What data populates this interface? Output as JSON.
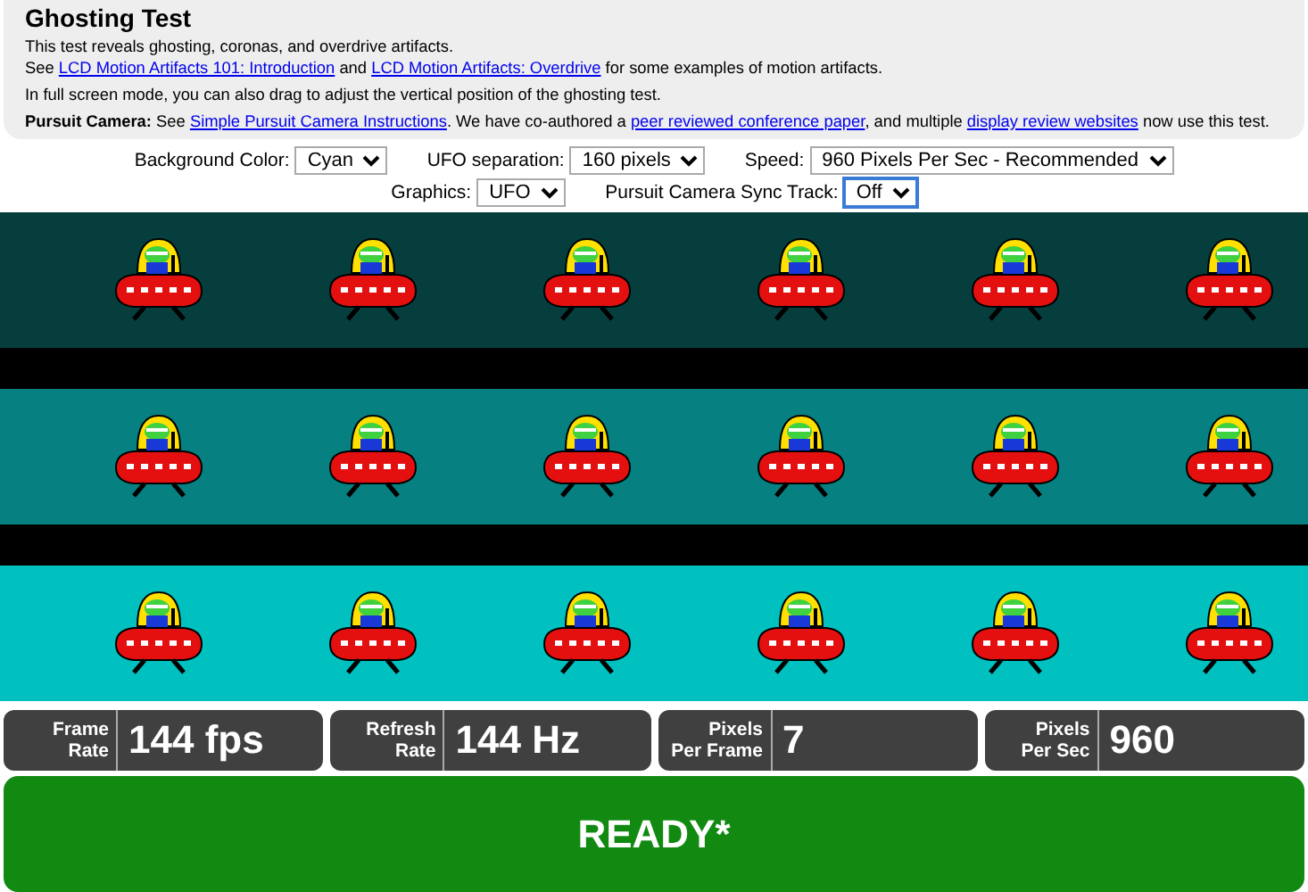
{
  "title": "Ghosting Test",
  "paragraphs": [
    [
      {
        "kind": "text",
        "text": "This test reveals ghosting, coronas, and overdrive artifacts."
      }
    ],
    [
      {
        "kind": "text",
        "text": "See "
      },
      {
        "kind": "link",
        "text": "LCD Motion Artifacts 101: Introduction"
      },
      {
        "kind": "text",
        "text": " and "
      },
      {
        "kind": "link",
        "text": "LCD Motion Artifacts: Overdrive"
      },
      {
        "kind": "text",
        "text": " for some examples of motion artifacts."
      }
    ],
    [
      {
        "kind": "text",
        "text": "In full screen mode, you can also drag to adjust the vertical position of the ghosting test."
      }
    ],
    [
      {
        "kind": "bold",
        "text": "Pursuit Camera:"
      },
      {
        "kind": "text",
        "text": " See "
      },
      {
        "kind": "link",
        "text": "Simple Pursuit Camera Instructions"
      },
      {
        "kind": "text",
        "text": ". We have co-authored a "
      },
      {
        "kind": "link",
        "text": "peer reviewed conference paper"
      },
      {
        "kind": "text",
        "text": ", and multiple "
      },
      {
        "kind": "link",
        "text": "display review websites"
      },
      {
        "kind": "text",
        "text": " now use this test."
      }
    ]
  ],
  "controls": [
    [
      {
        "label": "Background Color:",
        "value": "Cyan",
        "focused": false
      },
      {
        "label": "UFO separation:",
        "value": "160 pixels",
        "focused": false
      },
      {
        "label": "Speed:",
        "value": "960 Pixels Per Sec - Recommended",
        "focused": false
      }
    ],
    [
      {
        "label": "Graphics:",
        "value": "UFO",
        "focused": false
      },
      {
        "label": "Pursuit Camera Sync Track:",
        "value": "Off",
        "focused": true
      }
    ]
  ],
  "tracks": [
    {
      "color": "#063e3e"
    },
    {
      "color": "#068080"
    },
    {
      "color": "#00c0c0"
    }
  ],
  "stats": [
    {
      "label_lines": [
        "Frame",
        "Rate"
      ],
      "value": "144 fps"
    },
    {
      "label_lines": [
        "Refresh",
        "Rate"
      ],
      "value": "144 Hz"
    },
    {
      "label_lines": [
        "Pixels",
        "Per Frame"
      ],
      "value": "7"
    },
    {
      "label_lines": [
        "Pixels",
        "Per Sec"
      ],
      "value": "960"
    }
  ],
  "status_button": "READY*"
}
